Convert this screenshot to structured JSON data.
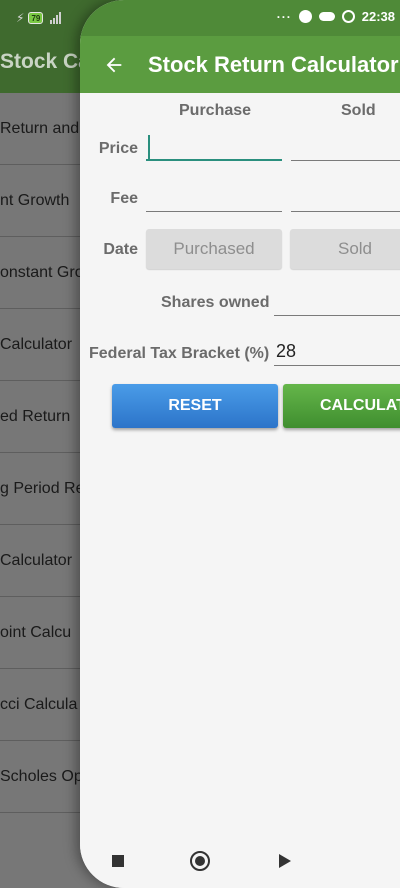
{
  "background_app": {
    "title": "Stock Cal",
    "items": [
      "Return and",
      "nt Growth",
      "onstant Gro",
      "Calculator",
      "ed Return",
      "g Period Re",
      "Calculator",
      "oint Calcu",
      "cci Calcula",
      "Scholes Op"
    ],
    "battery": "79"
  },
  "status": {
    "dots": "···",
    "time": "22:38"
  },
  "appbar": {
    "back_icon": "arrow-left-icon",
    "title": "Stock Return Calculator"
  },
  "form": {
    "col_purchase": "Purchase",
    "col_sold": "Sold",
    "price_label": "Price",
    "fee_label": "Fee",
    "date_label": "Date",
    "purchase_price": "",
    "sold_price": "",
    "purchase_fee": "",
    "sold_fee": "",
    "purchase_date_button": "Purchased",
    "sold_date_button": "Sold",
    "shares_label": "Shares owned",
    "shares_value": "",
    "tax_label": "Federal Tax Bracket (%)",
    "tax_value": "28"
  },
  "buttons": {
    "reset": "RESET",
    "calculate": "CALCULAT"
  },
  "colors": {
    "appbar": "#5b9c40",
    "focus": "#2a8f7e",
    "reset": "#2c74c9",
    "calculate": "#3f8e2f"
  }
}
